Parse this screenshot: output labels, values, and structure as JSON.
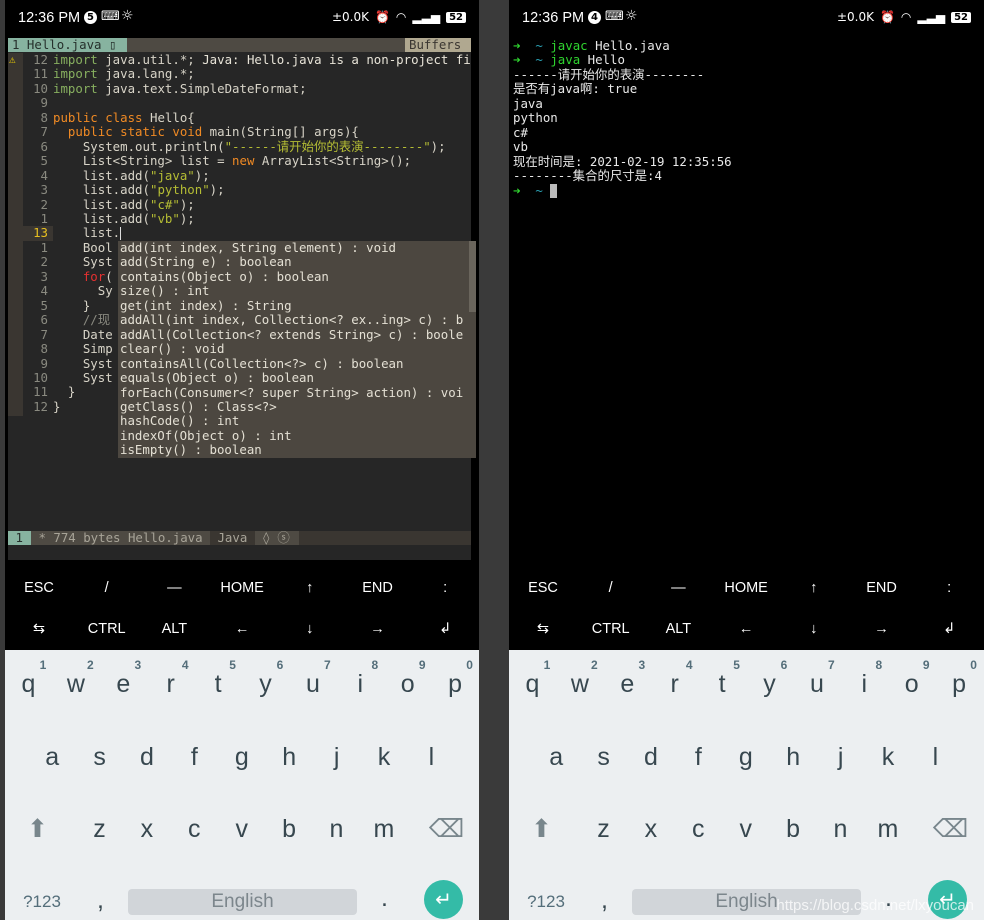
{
  "status_bar": {
    "time": "12:36 PM",
    "left_badge": "5",
    "right_badge": "4",
    "speed": "±0.0K",
    "battery": "52"
  },
  "editor": {
    "tab": "1 Hello.java ▯",
    "buffers": "Buffers",
    "lines": [
      {
        "n": "12",
        "s": [
          [
            "im",
            "import"
          ],
          [
            "tx",
            " java.util.*; "
          ],
          [
            "wm",
            "Java: Hello.java is a non-project fi"
          ]
        ]
      },
      {
        "n": "11",
        "s": [
          [
            "im",
            "import"
          ],
          [
            "tx",
            " java.lang.*;"
          ]
        ]
      },
      {
        "n": "10",
        "s": [
          [
            "im",
            "import"
          ],
          [
            "tx",
            " java.text.SimpleDateFormat;"
          ]
        ]
      },
      {
        "n": "9",
        "s": []
      },
      {
        "n": "8",
        "s": [
          [
            "kw",
            "public class"
          ],
          [
            "tx",
            " Hello{"
          ]
        ]
      },
      {
        "n": "7",
        "s": [
          [
            "tx",
            "  "
          ],
          [
            "kw",
            "public static void"
          ],
          [
            "tx",
            " main(String[] args){"
          ]
        ]
      },
      {
        "n": "6",
        "s": [
          [
            "tx",
            "    System.out.println("
          ],
          [
            "st",
            "\"------请开始你的表演--------\""
          ],
          [
            "tx",
            ");"
          ]
        ]
      },
      {
        "n": "5",
        "s": [
          [
            "tx",
            "    List<String> list = "
          ],
          [
            "kw",
            "new"
          ],
          [
            "tx",
            " ArrayList<String>();"
          ]
        ]
      },
      {
        "n": "4",
        "s": [
          [
            "tx",
            "    list.add("
          ],
          [
            "st",
            "\"java\""
          ],
          [
            "tx",
            ");"
          ]
        ]
      },
      {
        "n": "3",
        "s": [
          [
            "tx",
            "    list.add("
          ],
          [
            "st",
            "\"python\""
          ],
          [
            "tx",
            ");"
          ]
        ]
      },
      {
        "n": "2",
        "s": [
          [
            "tx",
            "    list.add("
          ],
          [
            "st",
            "\"c#\""
          ],
          [
            "tx",
            ");"
          ]
        ]
      },
      {
        "n": "1",
        "s": [
          [
            "tx",
            "    list.add("
          ],
          [
            "st",
            "\"vb\""
          ],
          [
            "tx",
            ");"
          ]
        ]
      },
      {
        "n": "13",
        "cur": true,
        "s": [
          [
            "tx",
            "    list."
          ]
        ]
      },
      {
        "n": "1",
        "s": [
          [
            "tx",
            "    Bool"
          ]
        ]
      },
      {
        "n": "2",
        "s": [
          [
            "tx",
            "    Syst"
          ]
        ]
      },
      {
        "n": "3",
        "s": [
          [
            "tx",
            "    "
          ],
          [
            "rd",
            "for"
          ],
          [
            "tx",
            "("
          ]
        ]
      },
      {
        "n": "4",
        "s": [
          [
            "tx",
            "      Sy"
          ]
        ]
      },
      {
        "n": "5",
        "s": [
          [
            "tx",
            "    }"
          ]
        ]
      },
      {
        "n": "6",
        "s": [
          [
            "cm",
            "    //现"
          ]
        ]
      },
      {
        "n": "7",
        "s": [
          [
            "tx",
            "    Date"
          ]
        ]
      },
      {
        "n": "8",
        "s": [
          [
            "tx",
            "    Simp"
          ]
        ]
      },
      {
        "n": "9",
        "s": [
          [
            "tx",
            "    Syst"
          ]
        ]
      },
      {
        "n": "10",
        "s": [
          [
            "tx",
            "    Syst"
          ]
        ]
      },
      {
        "n": "11",
        "s": [
          [
            "tx",
            "  }"
          ]
        ]
      },
      {
        "n": "12",
        "s": [
          [
            "tx",
            "}"
          ]
        ]
      }
    ],
    "completions": [
      "add(int index, String element) : void",
      "add(String e) : boolean",
      "contains(Object o) : boolean",
      "size() : int",
      "get(int index) : String",
      "addAll(int index, Collection<? ex..ing> c) : b",
      "addAll(Collection<? extends String> c) : boole",
      "clear() : void",
      "containsAll(Collection<?> c) : boolean",
      "equals(Object o) : boolean",
      "forEach(Consumer<? super String> action) : voi",
      "getClass() : Class<?>",
      "hashCode() : int",
      "indexOf(Object o) : int",
      "isEmpty() : boolean"
    ],
    "statusline": {
      "mode": "1",
      "file": "* 774 bytes Hello.java",
      "filetype": "Java",
      "extra": "◊ ⓢ"
    }
  },
  "terminal": {
    "lines": [
      [
        [
          "ar",
          "➜"
        ],
        [
          "ti",
          "  ~ "
        ],
        [
          "gr",
          "javac"
        ],
        [
          "tx",
          " Hello.java"
        ]
      ],
      [
        [
          "ar",
          "➜"
        ],
        [
          "ti",
          "  ~ "
        ],
        [
          "gr",
          "java"
        ],
        [
          "tx",
          " Hello"
        ]
      ],
      [
        [
          "tx",
          "------请开始你的表演--------"
        ]
      ],
      [
        [
          "tx",
          "是否有java啊: true"
        ]
      ],
      [
        [
          "tx",
          "java"
        ]
      ],
      [
        [
          "tx",
          "python"
        ]
      ],
      [
        [
          "tx",
          "c#"
        ]
      ],
      [
        [
          "tx",
          "vb"
        ]
      ],
      [
        [
          "tx",
          "现在时间是: 2021-02-19 12:35:56"
        ]
      ],
      [
        [
          "tx",
          "--------集合的尺寸是:4"
        ]
      ],
      [
        [
          "ar",
          "➜"
        ],
        [
          "ti",
          "  ~ "
        ]
      ]
    ]
  },
  "extra_keys": [
    [
      "ESC",
      "/",
      "—",
      "HOME",
      "↑",
      "END",
      ":"
    ],
    [
      "⇆",
      "CTRL",
      "ALT",
      "←",
      "↓",
      "→",
      "↲"
    ]
  ],
  "keyboard": {
    "row1": [
      "q",
      "w",
      "e",
      "r",
      "t",
      "y",
      "u",
      "i",
      "o",
      "p"
    ],
    "hints": [
      "1",
      "2",
      "3",
      "4",
      "5",
      "6",
      "7",
      "8",
      "9",
      "0"
    ],
    "row2": [
      "a",
      "s",
      "d",
      "f",
      "g",
      "h",
      "j",
      "k",
      "l"
    ],
    "row3": [
      "z",
      "x",
      "c",
      "v",
      "b",
      "n",
      "m"
    ],
    "symbols": "?123",
    "comma": ",",
    "space": "English",
    "period": ".",
    "shift_icon": "⬆",
    "backspace_icon": "⌫",
    "enter_icon": "↵"
  },
  "watermark": "https://blog.csdn.net/lxyoucan"
}
